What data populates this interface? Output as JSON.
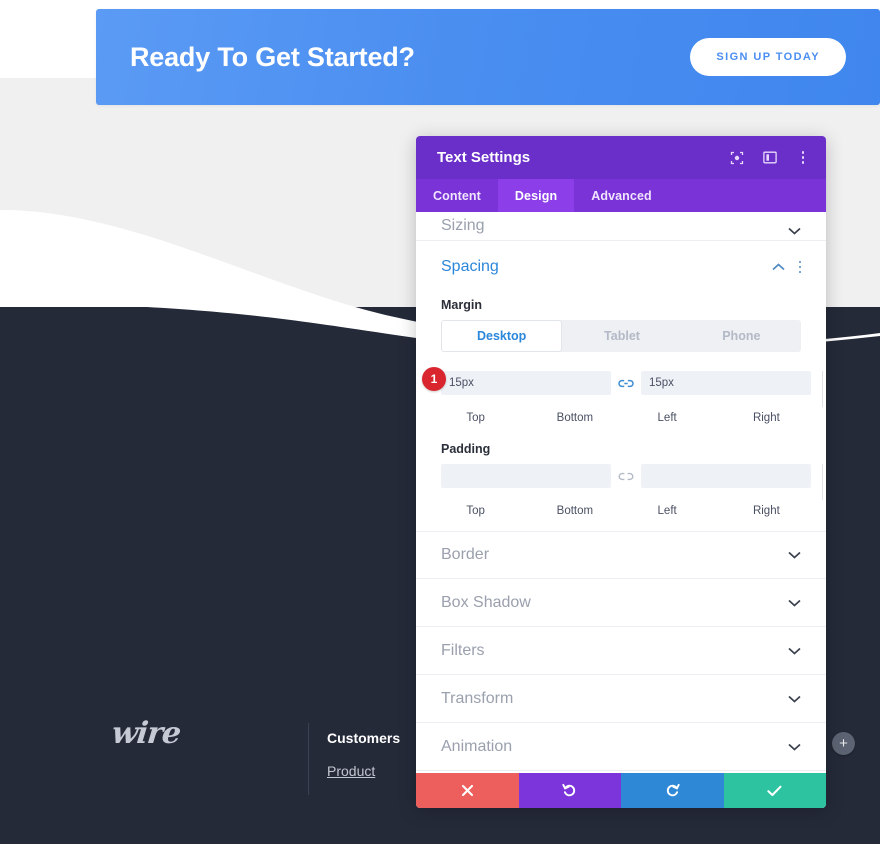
{
  "website": {
    "cta": {
      "title": "Ready To Get Started?",
      "button_label": "SIGN UP TODAY",
      "bg_color": "#4a8ef0"
    },
    "footer": {
      "logo_text": "wire",
      "columns": [
        {
          "heading": "Customers",
          "links": [
            "Product"
          ]
        }
      ],
      "bg_color": "#252a39"
    },
    "add_module_button": "+"
  },
  "modal": {
    "title": "Text Settings",
    "header_icons": [
      {
        "name": "focus-icon",
        "label": "Focus"
      },
      {
        "name": "layout-icon",
        "label": "Layout"
      },
      {
        "name": "more-vertical-icon",
        "label": "More options"
      }
    ],
    "tabs": [
      {
        "label": "Content",
        "active": false
      },
      {
        "label": "Design",
        "active": true
      },
      {
        "label": "Advanced",
        "active": false
      }
    ],
    "sections_above": [
      {
        "label": "Sizing",
        "open": false
      }
    ],
    "spacing": {
      "label": "Spacing",
      "open": true,
      "margin": {
        "label": "Margin",
        "devices": [
          {
            "label": "Desktop",
            "active": true
          },
          {
            "label": "Tablet",
            "active": false
          },
          {
            "label": "Phone",
            "active": false
          }
        ],
        "fields": [
          {
            "label": "Top",
            "value": "15px",
            "placeholder": ""
          },
          {
            "label": "Bottom",
            "value": "15px",
            "placeholder": ""
          },
          {
            "label": "Left",
            "value": "",
            "placeholder": ""
          },
          {
            "label": "Right",
            "value": "",
            "placeholder": ""
          }
        ],
        "link_top_bottom": "linked",
        "link_left_right": "unlinked"
      },
      "padding": {
        "label": "Padding",
        "fields": [
          {
            "label": "Top",
            "value": "",
            "placeholder": ""
          },
          {
            "label": "Bottom",
            "value": "",
            "placeholder": ""
          },
          {
            "label": "Left",
            "value": "",
            "placeholder": ""
          },
          {
            "label": "Right",
            "value": "",
            "placeholder": ""
          }
        ],
        "link_top_bottom": "unlinked",
        "link_left_right": "unlinked"
      }
    },
    "sections_below": [
      {
        "label": "Border",
        "open": false
      },
      {
        "label": "Box Shadow",
        "open": false
      },
      {
        "label": "Filters",
        "open": false
      },
      {
        "label": "Transform",
        "open": false
      },
      {
        "label": "Animation",
        "open": false
      }
    ],
    "footer_buttons": [
      {
        "name": "cancel-button",
        "icon": "close-icon",
        "color": "#ed5f5c"
      },
      {
        "name": "undo-button",
        "icon": "undo-icon",
        "color": "#7c35da"
      },
      {
        "name": "redo-button",
        "icon": "redo-icon",
        "color": "#2f88d6"
      },
      {
        "name": "save-button",
        "icon": "check-icon",
        "color": "#2ec3a0"
      }
    ],
    "annotation_badge": "1",
    "colors": {
      "header": "#6b2fc9",
      "tabbar": "#7a33d6",
      "tab_active": "#8c3ee8",
      "accent_blue": "#2b87da",
      "badge_red": "#d9262e"
    }
  }
}
